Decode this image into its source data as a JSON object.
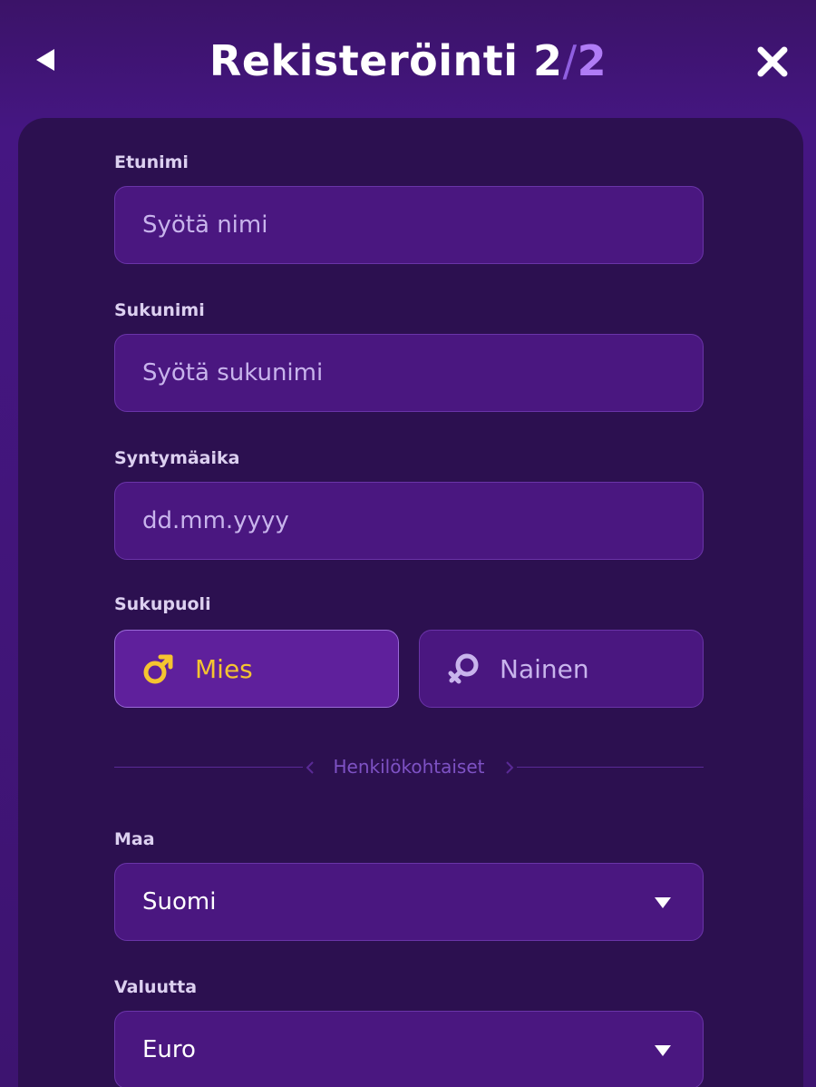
{
  "header": {
    "title": "Rekisteröinti",
    "step_current": "2",
    "step_separator": "/",
    "step_total": "2"
  },
  "form": {
    "first_name": {
      "label": "Etunimi",
      "placeholder": "Syötä nimi"
    },
    "last_name": {
      "label": "Sukunimi",
      "placeholder": "Syötä sukunimi"
    },
    "birthdate": {
      "label": "Syntymäaika",
      "placeholder": "dd.mm.yyyy"
    },
    "gender": {
      "label": "Sukupuoli",
      "options": [
        {
          "label": "Mies",
          "icon": "male-symbol-icon",
          "selected": true
        },
        {
          "label": "Nainen",
          "icon": "female-symbol-icon",
          "selected": false
        }
      ]
    },
    "section_divider": "Henkilökohtaiset",
    "country": {
      "label": "Maa",
      "value": "Suomi"
    },
    "currency": {
      "label": "Valuutta",
      "value": "Euro"
    }
  },
  "colors": {
    "background": "#451682",
    "panel": "#2c1050",
    "input": "#4a1780",
    "accent_yellow": "#f5c430",
    "accent_purple": "#b07cf6"
  }
}
